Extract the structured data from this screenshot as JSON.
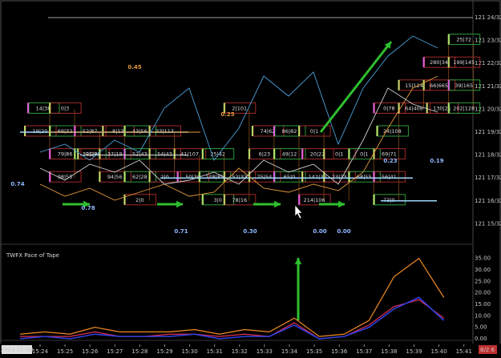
{
  "chart_data": {
    "type": "line",
    "price_axis": {
      "unit": "32nds",
      "labels": [
        "121 24/32",
        "121 23/32",
        "121 22/32",
        "121 21/32",
        "121 20/32",
        "121 19/32",
        "121 18/32",
        "121 17/32",
        "121 16/32",
        "121 15/32"
      ],
      "range": [
        121.4375,
        121.78125
      ]
    },
    "x": [
      "15:24",
      "15:25",
      "15:26",
      "15:27",
      "15:28",
      "15:29",
      "15:30",
      "15:31",
      "15:32",
      "15:33",
      "15:34",
      "15:35",
      "15:36",
      "15:37",
      "15:38",
      "15:39",
      "15:40",
      "15:41"
    ],
    "date_label": "2023-11-28",
    "footprints": [
      {
        "x": "15:24",
        "y": 20,
        "text": "14|38"
      },
      {
        "x": "15:25",
        "y": 20,
        "text": "0|3"
      },
      {
        "x": "15:24",
        "y": 19,
        "text": "19|20"
      },
      {
        "x": "15:25",
        "y": 19,
        "text": "69|32"
      },
      {
        "x": "15:26",
        "y": 19,
        "text": "52|87"
      },
      {
        "x": "15:27",
        "y": 19,
        "text": "8|13"
      },
      {
        "x": "15:28",
        "y": 19,
        "text": "43|56"
      },
      {
        "x": "15:29",
        "y": 19,
        "text": "33|113"
      },
      {
        "x": "15:25",
        "y": 18,
        "text": "79|86"
      },
      {
        "x": "15:26",
        "y": 18,
        "text": "32|29"
      },
      {
        "x": "15:26",
        "y": 18,
        "text": "95|89"
      },
      {
        "x": "15:27",
        "y": 18,
        "text": "37|19"
      },
      {
        "x": "15:28",
        "y": 18,
        "text": "52|43"
      },
      {
        "x": "15:29",
        "y": 18,
        "text": "54|43"
      },
      {
        "x": "15:30",
        "y": 18,
        "text": "41|107"
      },
      {
        "x": "15:31",
        "y": 18,
        "text": "25|42"
      },
      {
        "x": "15:25",
        "y": 17,
        "text": "98|55"
      },
      {
        "x": "15:27",
        "y": 17,
        "text": "94|56"
      },
      {
        "x": "15:28",
        "y": 17,
        "text": "62|28"
      },
      {
        "x": "15:29",
        "y": 17,
        "text": "2|0"
      },
      {
        "x": "15:30",
        "y": 17,
        "text": "50|30"
      },
      {
        "x": "15:31",
        "y": 17,
        "text": "148|85"
      },
      {
        "x": "15:32",
        "y": 17,
        "text": "52|32"
      },
      {
        "x": "15:33",
        "y": 17,
        "text": "75|54"
      },
      {
        "x": "15:34",
        "y": 17,
        "text": "65|0"
      },
      {
        "x": "15:35",
        "y": 17,
        "text": "142|30"
      },
      {
        "x": "15:36",
        "y": 17,
        "text": "23|73"
      },
      {
        "x": "15:37",
        "y": 17,
        "text": "68|55"
      },
      {
        "x": "15:38",
        "y": 17,
        "text": "56|41"
      },
      {
        "x": "15:28",
        "y": 16,
        "text": "2|0"
      },
      {
        "x": "15:31",
        "y": 16,
        "text": "3|0"
      },
      {
        "x": "15:32",
        "y": 16,
        "text": "78|16"
      },
      {
        "x": "15:35",
        "y": 16,
        "text": "214|106"
      },
      {
        "x": "15:38",
        "y": 16,
        "text": "73|0"
      },
      {
        "x": "15:32",
        "y": 20,
        "text": "2|101"
      },
      {
        "x": "15:33",
        "y": 19,
        "text": "74|62"
      },
      {
        "x": "15:34",
        "y": 19,
        "text": "86|82"
      },
      {
        "x": "15:35",
        "y": 19,
        "text": "0|1"
      },
      {
        "x": "15:33",
        "y": 18,
        "text": "6|23"
      },
      {
        "x": "15:34",
        "y": 18,
        "text": "49|12"
      },
      {
        "x": "15:35",
        "y": 18,
        "text": "20|22"
      },
      {
        "x": "15:36",
        "y": 18,
        "text": "0|1"
      },
      {
        "x": "15:37",
        "y": 18,
        "text": "0|1"
      },
      {
        "x": "15:38",
        "y": 18,
        "text": "69|71"
      },
      {
        "x": "15:38",
        "y": 20,
        "text": "0|78"
      },
      {
        "x": "15:38",
        "y": 19,
        "text": "24|108"
      },
      {
        "x": "15:39",
        "y": 21,
        "text": "15|124"
      },
      {
        "x": "15:40",
        "y": 21,
        "text": "66|665"
      },
      {
        "x": "15:41",
        "y": 21,
        "text": "39|165"
      },
      {
        "x": "15:39",
        "y": 20,
        "text": "64|408"
      },
      {
        "x": "15:40",
        "y": 20,
        "text": "130|21"
      },
      {
        "x": "15:41",
        "y": 20,
        "text": "202|128"
      },
      {
        "x": "15:40",
        "y": 22,
        "text": "280|34"
      },
      {
        "x": "15:41",
        "y": 22,
        "text": "199|145"
      },
      {
        "x": "15:41",
        "y": 23,
        "text": "25|72"
      }
    ],
    "annotations": [
      {
        "text": "0.45",
        "color": "#e69a3c"
      },
      {
        "text": "0.25",
        "color": "#e69a3c"
      },
      {
        "text": "0.74",
        "color": "#8fb8ff"
      },
      {
        "text": "0.78",
        "color": "#8fb8ff"
      },
      {
        "text": "0.71",
        "color": "#8fb8ff"
      },
      {
        "text": "0.30",
        "color": "#8fb8ff"
      },
      {
        "text": "0.00",
        "color": "#8fb8ff"
      },
      {
        "text": "0.00",
        "color": "#8fb8ff"
      },
      {
        "text": "0.23",
        "color": "#8fb8ff"
      },
      {
        "text": "0.19",
        "color": "#8fb8ff"
      }
    ],
    "lower_panel": {
      "title": "TWFX Pace of Tape",
      "y_labels": [
        "35.00",
        "30.00",
        "25.00",
        "20.00",
        "15.00",
        "10.00",
        "5.00",
        "0.00"
      ],
      "ylim": [
        0,
        38
      ],
      "series": [
        {
          "color": "#f08a24",
          "values": [
            2,
            3,
            2,
            5,
            3,
            3,
            3,
            4,
            2,
            4,
            3,
            9,
            1,
            2,
            8,
            27,
            35,
            18
          ]
        },
        {
          "color": "#e0305a",
          "values": [
            1,
            1,
            1,
            3,
            1,
            1,
            2,
            2,
            1,
            2,
            1,
            7,
            0,
            1,
            6,
            14,
            17,
            9
          ]
        },
        {
          "color": "#3040e0",
          "values": [
            0,
            1,
            0,
            2,
            1,
            1,
            1,
            2,
            0,
            1,
            1,
            6,
            0,
            1,
            5,
            13,
            18,
            8
          ]
        }
      ]
    },
    "badge": "8/2 6"
  }
}
